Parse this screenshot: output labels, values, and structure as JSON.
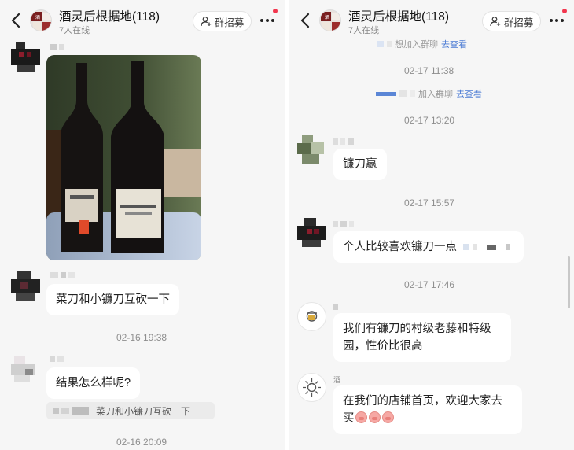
{
  "left": {
    "header": {
      "title": "酒灵后根据地(118)",
      "subtitle": "7人在线",
      "recruit_label": "群招募"
    },
    "messages": [
      {
        "type": "image",
        "description_icon": "wine-bottles-photo"
      },
      {
        "type": "text",
        "text": "菜刀和小镰刀互砍一下"
      },
      {
        "type": "time",
        "text": "02-16 19:38"
      },
      {
        "type": "text",
        "text": "结果怎么样呢?",
        "quote": "菜刀和小镰刀互砍一下"
      },
      {
        "type": "time",
        "text": "02-16 20:09"
      }
    ]
  },
  "right": {
    "header": {
      "title": "酒灵后根据地(118)",
      "subtitle": "7人在线",
      "recruit_label": "群招募"
    },
    "system_1": {
      "text": "想加入群聊",
      "link": "去查看"
    },
    "time_1": "02-17 11:38",
    "system_2": {
      "text": "加入群聊",
      "link": "去查看"
    },
    "time_2": "02-17 13:20",
    "msg_1": "镰刀赢",
    "time_3": "02-17 15:57",
    "msg_2": "个人比较喜欢镰刀一点",
    "time_4": "02-17 17:46",
    "msg_3": "我们有镰刀的村级老藤和特级园，性价比很高",
    "sender_4": "酒",
    "msg_4": "在我们的店铺首页，欢迎大家去买"
  },
  "colors": {
    "link": "#4b7bd4",
    "badge": "#f2364e",
    "background": "#f6f6f6"
  }
}
